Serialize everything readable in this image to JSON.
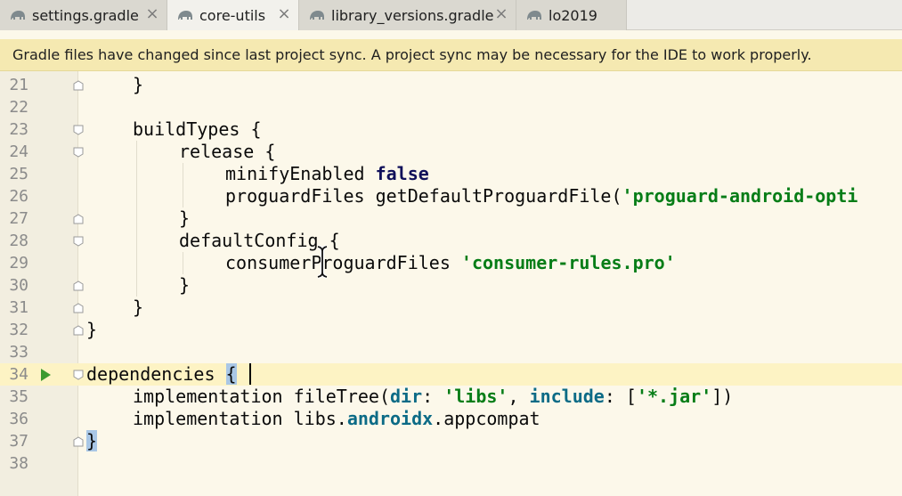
{
  "tabs": [
    {
      "label": "settings.gradle",
      "icon": "gradle-elephant-icon",
      "active": false
    },
    {
      "label": "core-utils",
      "icon": "gradle-elephant-icon",
      "active": true
    },
    {
      "label": "library_versions.gradle",
      "icon": "gradle-elephant-icon",
      "active": false
    },
    {
      "label": "lo2019",
      "icon": "gradle-elephant-icon",
      "active": false
    }
  ],
  "close_glyph": "×",
  "notification": {
    "text": "Gradle files have changed since last project sync. A project sync may be necessary for the IDE to work properly."
  },
  "editor": {
    "current_line": 34,
    "lines": [
      {
        "n": "21"
      },
      {
        "n": "22"
      },
      {
        "n": "23"
      },
      {
        "n": "24"
      },
      {
        "n": "25"
      },
      {
        "n": "26"
      },
      {
        "n": "27"
      },
      {
        "n": "28"
      },
      {
        "n": "29"
      },
      {
        "n": "30"
      },
      {
        "n": "31"
      },
      {
        "n": "32"
      },
      {
        "n": "33"
      },
      {
        "n": "34"
      },
      {
        "n": "35"
      },
      {
        "n": "36"
      },
      {
        "n": "37"
      },
      {
        "n": "38"
      }
    ],
    "code": {
      "l21": "}",
      "l23": "buildTypes {",
      "l24": "release {",
      "l25_a": "minifyEnabled ",
      "l25_b": "false",
      "l26_a": "proguardFiles getDefaultProguardFile(",
      "l26_b": "'proguard-android-opti",
      "l27": "}",
      "l28": "defaultConfig {",
      "l29_a": "consumerProguardFiles ",
      "l29_b": "'consumer-rules.pro'",
      "l30": "}",
      "l31": "}",
      "l32": "}",
      "l34_a": "dependencies ",
      "l34_b": "{",
      "l35_a": "implementation fileTree(",
      "l35_b": "dir",
      "l35_c": ": ",
      "l35_d": "'libs'",
      "l35_e": ", ",
      "l35_f": "include",
      "l35_g": ": [",
      "l35_h": "'*.jar'",
      "l35_i": "])",
      "l36_a": "implementation libs.",
      "l36_b": "androidx",
      "l36_c": ".appcompat",
      "l37": "}"
    }
  },
  "colors": {
    "editor_bg": "#fcf8ea",
    "notification_bg": "#f5e9b1",
    "current_line_bg": "#fdf3c4",
    "keyword": "#10105a",
    "string": "#067d17",
    "run_icon": "#3c9a2f",
    "brace_highlight": "#a9c7e6"
  }
}
